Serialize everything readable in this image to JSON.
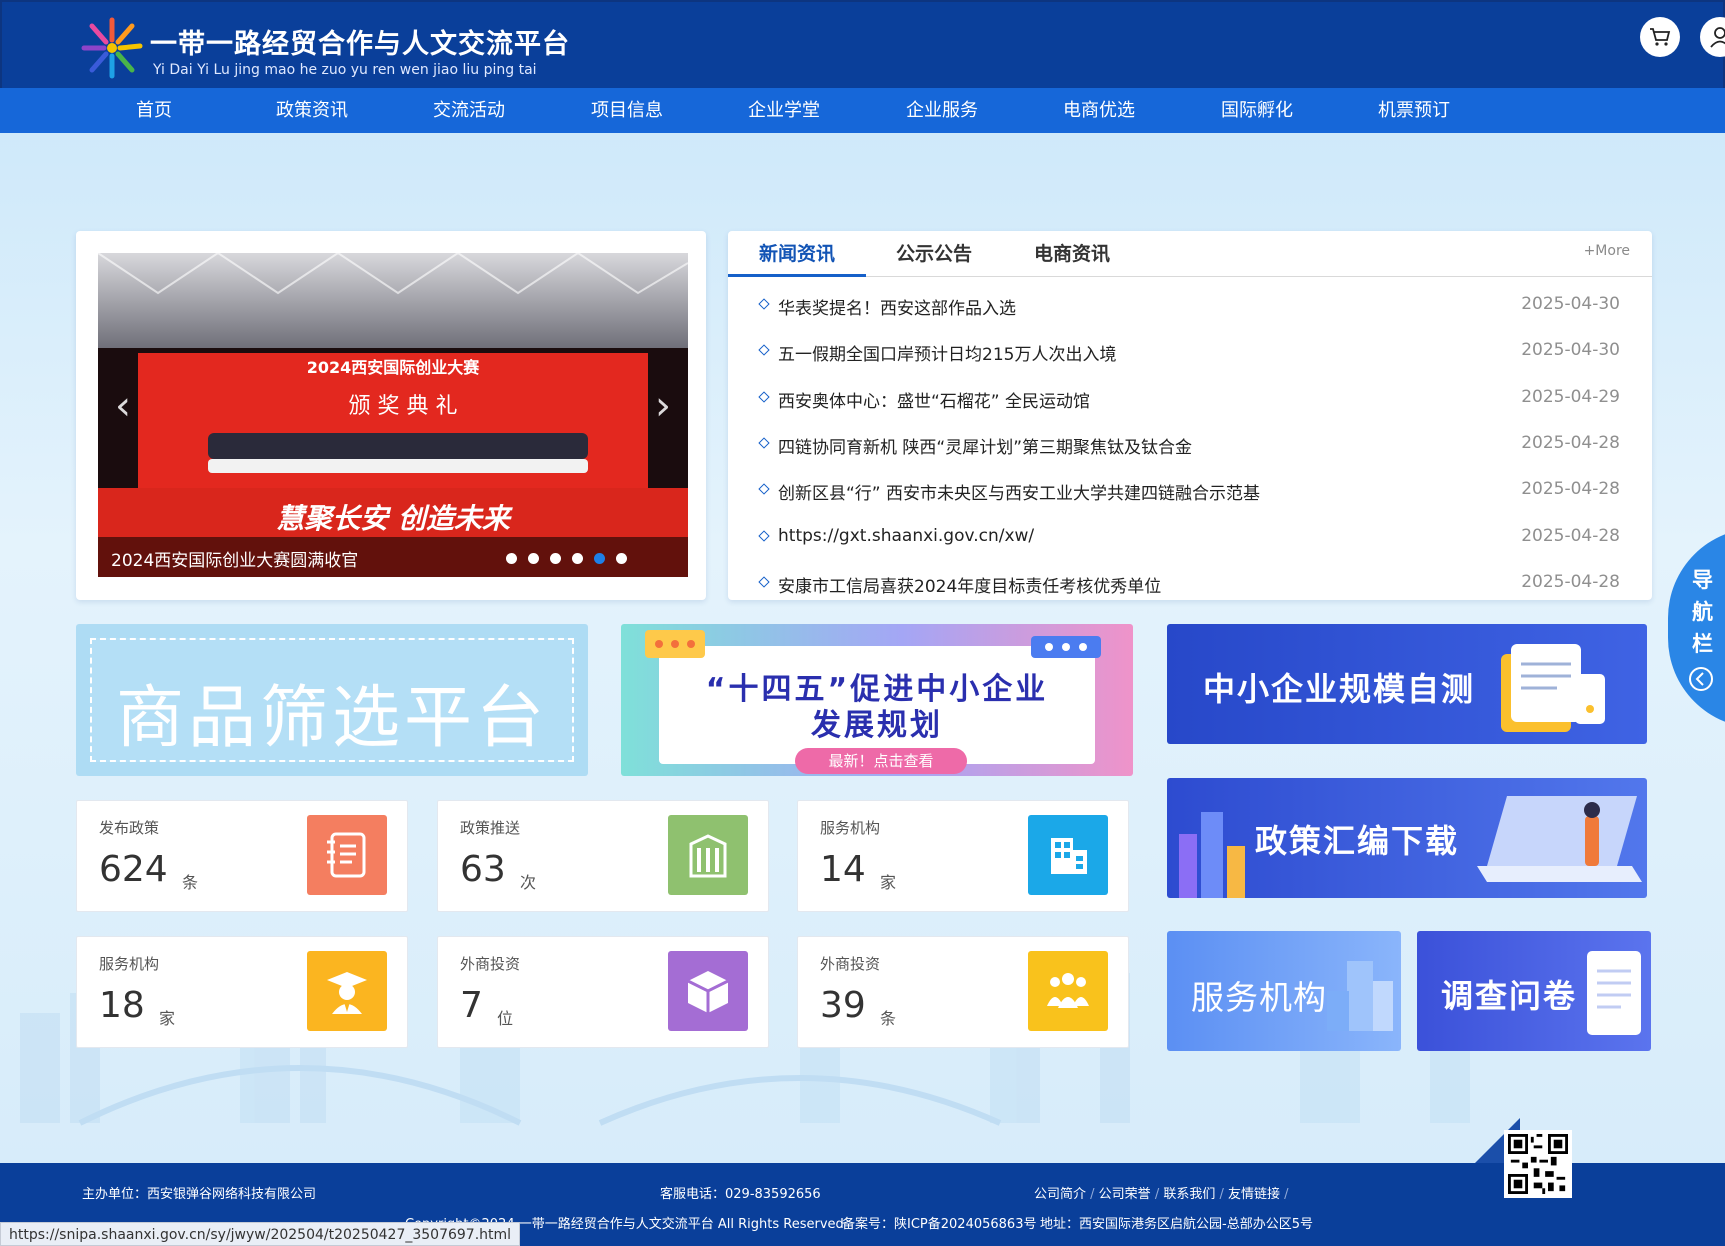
{
  "header": {
    "title": "一带一路经贸合作与人文交流平台",
    "subtitle": "Yi Dai Yi Lu jing mao he zuo yu ren wen jiao liu ping tai",
    "cart_icon": "cart-icon",
    "user_icon": "user-icon"
  },
  "nav": {
    "items": [
      {
        "label": "首页"
      },
      {
        "label": "政策资讯"
      },
      {
        "label": "交流活动"
      },
      {
        "label": "项目信息"
      },
      {
        "label": "企业学堂"
      },
      {
        "label": "企业服务"
      },
      {
        "label": "电商优选"
      },
      {
        "label": "国际孵化"
      },
      {
        "label": "机票预订"
      }
    ]
  },
  "carousel": {
    "caption": "2024西安国际创业大赛圆满收官",
    "slide_stage_text": "2024西安国际创业大赛",
    "slide_banner_text": "颁 奖 典 礼",
    "slide_slogan": "慧聚长安  创造未来",
    "slide_count": 6,
    "active_index": 4
  },
  "news": {
    "tabs": [
      {
        "label": "新闻资讯"
      },
      {
        "label": "公示公告"
      },
      {
        "label": "电商资讯"
      }
    ],
    "active_tab": 0,
    "more_label": "+More",
    "items": [
      {
        "title": "华表奖提名！西安这部作品入选",
        "date": "2025-04-30"
      },
      {
        "title": "五一假期全国口岸预计日均215万人次出入境",
        "date": "2025-04-30"
      },
      {
        "title": "西安奥体中心：盛世“石榴花” 全民运动馆",
        "date": "2025-04-29"
      },
      {
        "title": "四链协同育新机  陕西“灵犀计划”第三期聚焦钛及钛合金",
        "date": "2025-04-28"
      },
      {
        "title": "创新区县“行” 西安市未央区与西安工业大学共建四链融合示范基",
        "date": "2025-04-28"
      },
      {
        "title": "https://gxt.shaanxi.gov.cn/xw/",
        "date": "2025-04-28"
      },
      {
        "title": "安康市工信局喜获2024年度目标责任考核优秀单位",
        "date": "2025-04-28"
      }
    ]
  },
  "banners": {
    "product": "商品筛选平台",
    "plan_line1": "“十四五”促进中小企业",
    "plan_line2": "发展规划",
    "plan_pill": "最新！点击查看",
    "scale": "中小企业规模自测",
    "policy": "政策汇编下载",
    "service": "服务机构",
    "survey": "调查问卷"
  },
  "stats": [
    {
      "label": "发布政策",
      "value": "624",
      "unit": "条",
      "color": "#f47e60",
      "icon": "notebook-icon"
    },
    {
      "label": "政策推送",
      "value": "63",
      "unit": "次",
      "color": "#8fc16f",
      "icon": "building-icon"
    },
    {
      "label": "服务机构",
      "value": "14",
      "unit": "家",
      "color": "#1ba8e8",
      "icon": "office-icon"
    },
    {
      "label": "服务机构",
      "value": "18",
      "unit": "家",
      "color": "#fbb520",
      "icon": "graduate-icon"
    },
    {
      "label": "外商投资",
      "value": "7",
      "unit": "位",
      "color": "#a46dd4",
      "icon": "box-icon"
    },
    {
      "label": "外商投资",
      "value": "39",
      "unit": "条",
      "color": "#f9c21c",
      "icon": "people-icon"
    }
  ],
  "sidenav": {
    "label": "导航栏"
  },
  "footer": {
    "host": "主办单位：西安银弹谷网络科技有限公司",
    "phone": "客服电话：029-83592656",
    "links": [
      "公司简介",
      "公司荣誉",
      "联系我们",
      "友情链接"
    ],
    "copyright": "Copyright©2024  一带一路经贸合作与人文交流平台 All Rights Reserved",
    "icp": "备案号：陕ICP备2024056863号",
    "address": "地址：西安国际港务区启航公园-总部办公区5号"
  },
  "status_url": "https://snipa.shaanxi.gov.cn/sy/jwyw/202504/t20250427_3507697.html"
}
